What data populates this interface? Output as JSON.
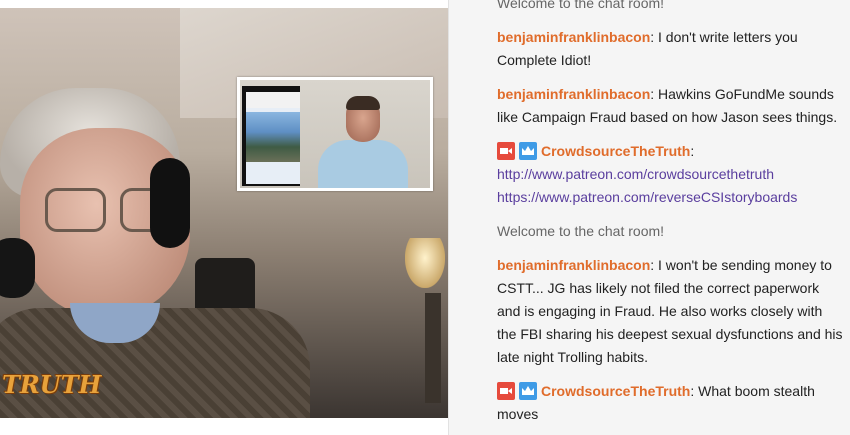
{
  "video": {
    "watermark": "TRUTH"
  },
  "chat": {
    "messages": [
      {
        "type": "system",
        "text": "Welcome to the chat room!"
      },
      {
        "type": "user",
        "username": "benjaminfranklinbacon",
        "text": "I don't write letters you Complete Idiot!"
      },
      {
        "type": "user",
        "username": "benjaminfranklinbacon",
        "text": "Hawkins GoFundMe sounds like Campaign Fraud based on how Jason sees things."
      },
      {
        "type": "host",
        "username": "CrowdsourceTheTruth",
        "badges": [
          "camera-icon",
          "crown-icon"
        ],
        "links": [
          "http://www.patreon.com/crowdsourcethetruth",
          "https://www.patreon.com/reverseCSIstoryboards"
        ]
      },
      {
        "type": "system",
        "text": "Welcome to the chat room!"
      },
      {
        "type": "user",
        "username": "benjaminfranklinbacon",
        "text": "I won't be sending money to CSTT... JG has likely not filed the correct paperwork and is engaging in Fraud. He also works closely with the FBI sharing his deepest sexual dysfunctions and his late night Trolling habits."
      },
      {
        "type": "host",
        "username": "CrowdsourceTheTruth",
        "badges": [
          "camera-icon",
          "crown-icon"
        ],
        "text": "What boom stealth moves"
      }
    ]
  },
  "colors": {
    "username": "#e06c2b",
    "link": "#5a3e9e",
    "camera_badge": "#e64a3c",
    "crown_badge": "#3f9be6"
  }
}
